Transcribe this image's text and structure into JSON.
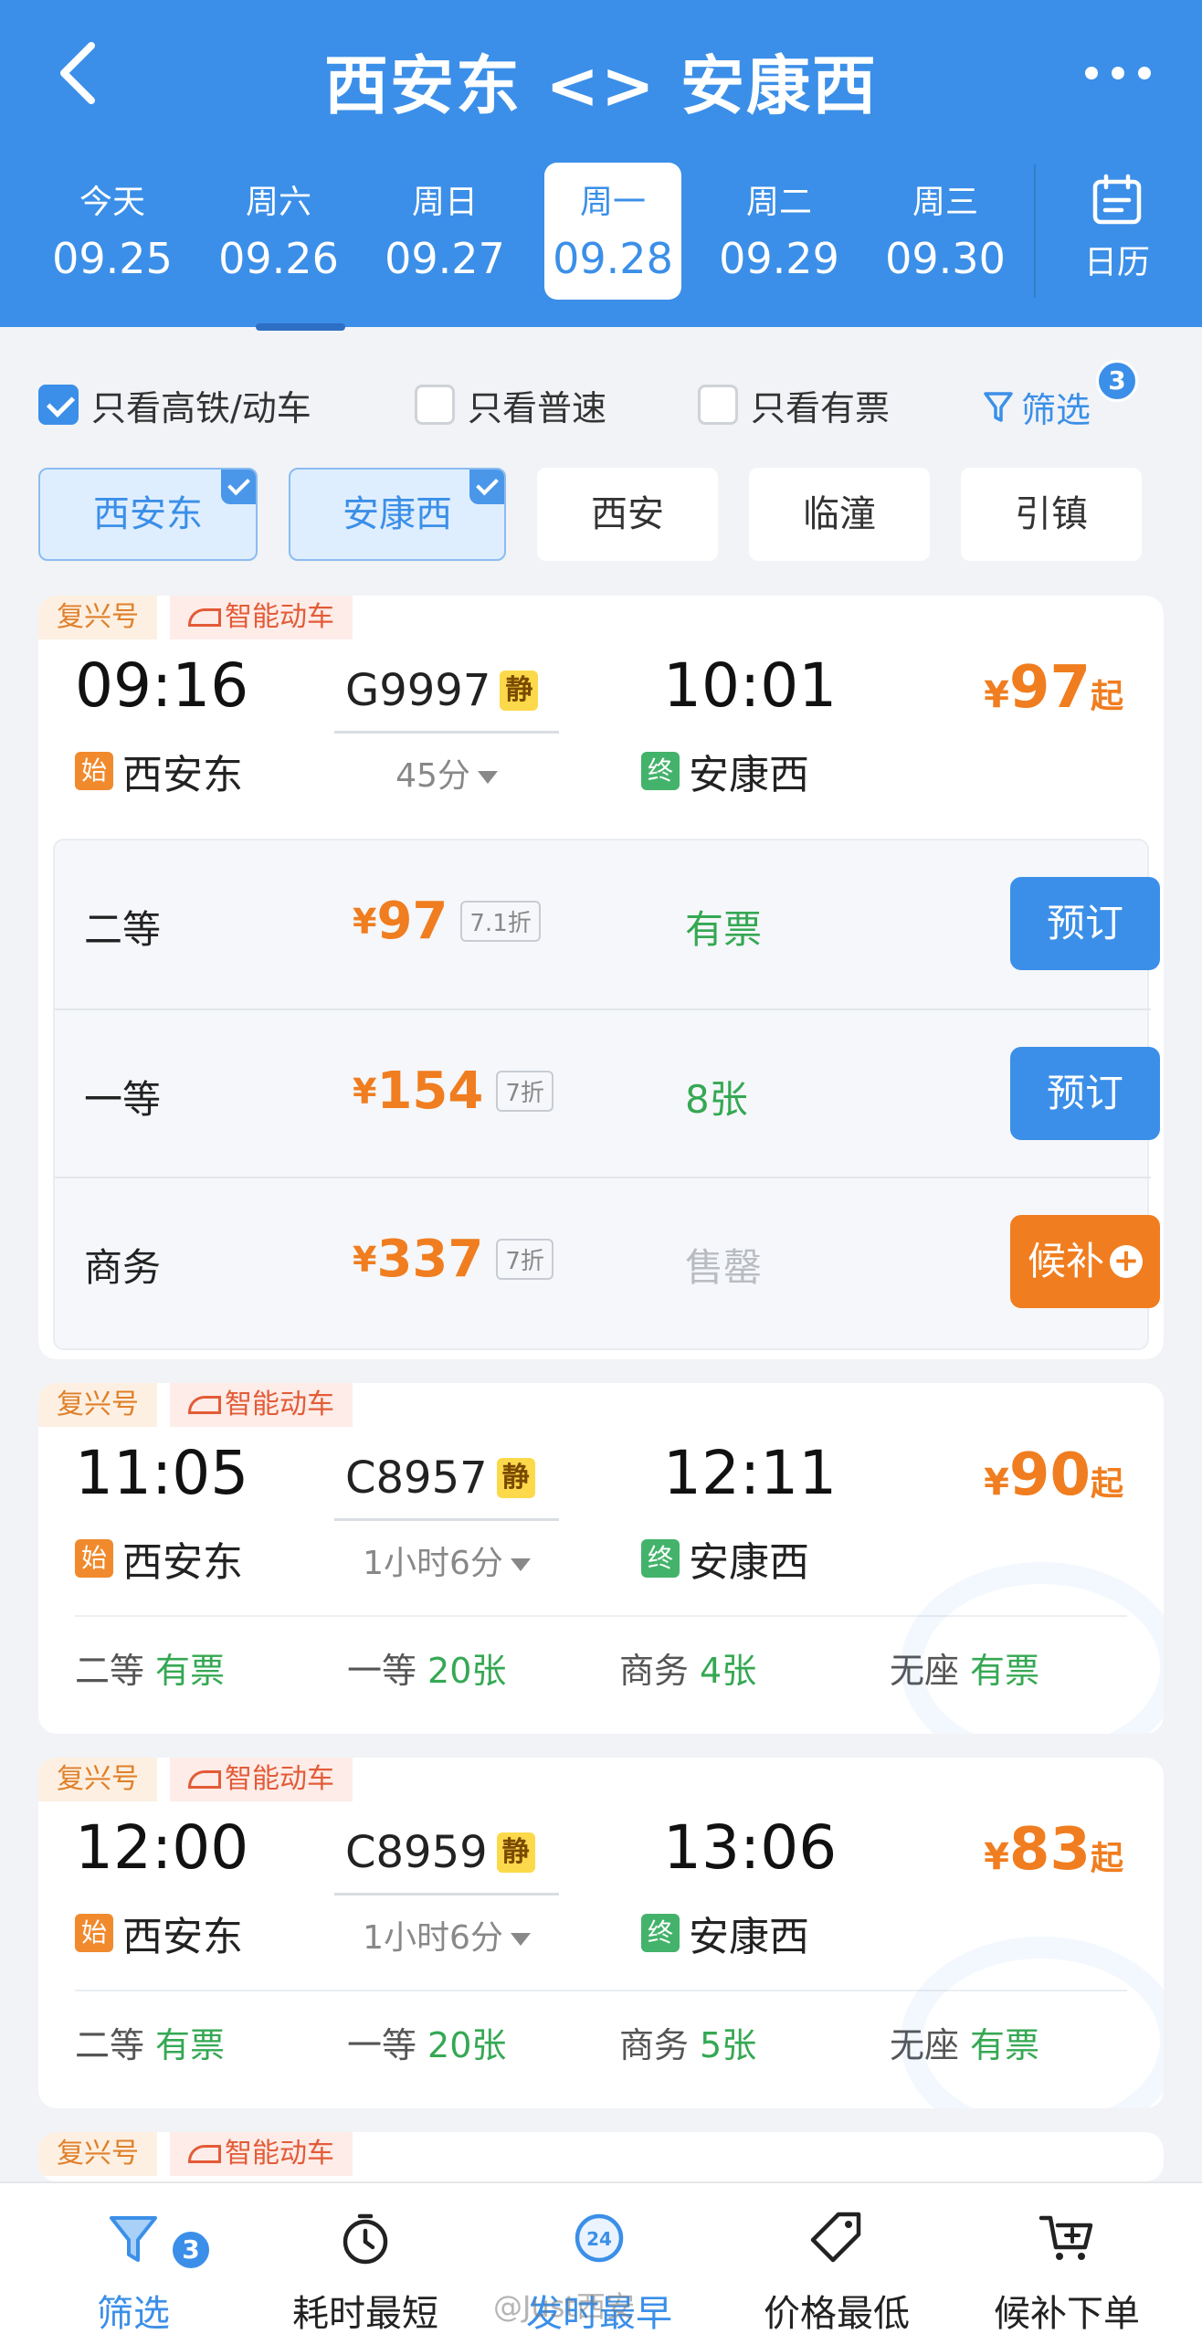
{
  "header": {
    "title": "西安东 <> 安康西",
    "dates": [
      {
        "weekday": "今天",
        "date": "09.25"
      },
      {
        "weekday": "周六",
        "date": "09.26"
      },
      {
        "weekday": "周日",
        "date": "09.27"
      },
      {
        "weekday": "周一",
        "date": "09.28",
        "active": true
      },
      {
        "weekday": "周二",
        "date": "09.29"
      },
      {
        "weekday": "周三",
        "date": "09.30"
      }
    ],
    "calendar_label": "日历",
    "colors": {
      "primary": "#3b8fe8",
      "orange": "#f07d1f",
      "green": "#35a853"
    }
  },
  "filters": {
    "high_speed": {
      "label": "只看高铁/动车",
      "checked": true
    },
    "normal": {
      "label": "只看普速",
      "checked": false
    },
    "available": {
      "label": "只看有票",
      "checked": false
    },
    "filter_label": "筛选",
    "filter_count": "3"
  },
  "stations": [
    {
      "name": "西安东",
      "selected": true
    },
    {
      "name": "安康西",
      "selected": true
    },
    {
      "name": "西安",
      "selected": false
    },
    {
      "name": "临潼",
      "selected": false
    },
    {
      "name": "引镇",
      "selected": false
    }
  ],
  "trains": [
    {
      "tags": [
        "复兴号",
        "智能动车"
      ],
      "depart": "09:16",
      "arrive": "10:01",
      "number": "G9997",
      "quiet": "静",
      "duration": "45分",
      "from_mark": "始",
      "from": "西安东",
      "to_mark": "终",
      "to": "安康西",
      "currency": "¥",
      "price": "97",
      "price_suffix": "起",
      "seats": [
        {
          "name": "二等",
          "price": "97",
          "discount": "7.1折",
          "avail": "有票",
          "action": "预订"
        },
        {
          "name": "一等",
          "price": "154",
          "discount": "7折",
          "avail": "8张",
          "action": "预订"
        },
        {
          "name": "商务",
          "price": "337",
          "discount": "7折",
          "avail": "售罄",
          "action": "候补"
        }
      ]
    },
    {
      "tags": [
        "复兴号",
        "智能动车"
      ],
      "depart": "11:05",
      "arrive": "12:11",
      "number": "C8957",
      "quiet": "静",
      "duration": "1小时6分",
      "from_mark": "始",
      "from": "西安东",
      "to_mark": "终",
      "to": "安康西",
      "currency": "¥",
      "price": "90",
      "price_suffix": "起",
      "summary": [
        {
          "name": "二等",
          "value": "有票"
        },
        {
          "name": "一等",
          "value": "20张"
        },
        {
          "name": "商务",
          "value": "4张"
        },
        {
          "name": "无座",
          "value": "有票"
        }
      ]
    },
    {
      "tags": [
        "复兴号",
        "智能动车"
      ],
      "depart": "12:00",
      "arrive": "13:06",
      "number": "C8959",
      "quiet": "静",
      "duration": "1小时6分",
      "from_mark": "始",
      "from": "西安东",
      "to_mark": "终",
      "to": "安康西",
      "currency": "¥",
      "price": "83",
      "price_suffix": "起",
      "summary": [
        {
          "name": "二等",
          "value": "有票"
        },
        {
          "name": "一等",
          "value": "20张"
        },
        {
          "name": "商务",
          "value": "5张"
        },
        {
          "name": "无座",
          "value": "有票"
        }
      ]
    },
    {
      "tags": [
        "复兴号",
        "智能动车"
      ]
    }
  ],
  "bottom_bar": [
    {
      "label": "筛选",
      "icon": "funnel-icon",
      "badge": "3",
      "active": true
    },
    {
      "label": "耗时最短",
      "icon": "stopwatch-icon"
    },
    {
      "label": "发时最早",
      "icon": "clock-24-icon",
      "active": true
    },
    {
      "label": "价格最低",
      "icon": "price-tag-icon"
    },
    {
      "label": "候补下单",
      "icon": "cart-plus-icon"
    }
  ],
  "watermark": "@Just西安"
}
